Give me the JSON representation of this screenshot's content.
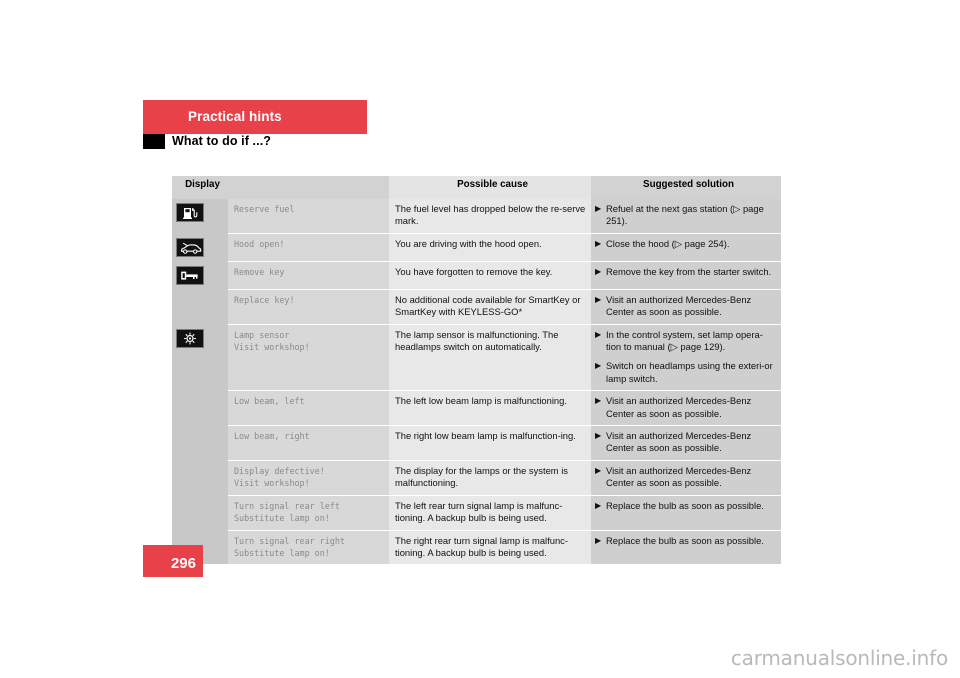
{
  "header": {
    "chapter": "Practical hints",
    "section_title": "What to do if ...?"
  },
  "page_number": "296",
  "watermark": "carmanualsonline.info",
  "table": {
    "columns": {
      "display": "Display",
      "possible_cause": "Possible cause",
      "suggested_solution": "Suggested solution"
    },
    "rows": [
      {
        "icon": "fuel-pump-icon",
        "display": "Reserve fuel",
        "cause": "The fuel level has dropped below the re-serve mark.",
        "solutions": [
          "Refuel at the next gas station (▷ page 251)."
        ]
      },
      {
        "icon": "hood-open-icon",
        "display": "Hood open!",
        "cause": "You are driving with the hood open.",
        "solutions": [
          "Close the hood (▷ page 254)."
        ]
      },
      {
        "icon": "key-icon",
        "display": "Remove key",
        "cause": "You have forgotten to remove the key.",
        "solutions": [
          "Remove the key from the starter switch."
        ]
      },
      {
        "icon": "",
        "display": "Replace key!",
        "cause": "No additional code available for SmartKey or SmartKey with KEYLESS-GO*",
        "solutions": [
          "Visit an authorized Mercedes-Benz Center as soon as possible."
        ]
      },
      {
        "icon": "lamp-sensor-icon",
        "display": "Lamp sensor\nVisit workshop!",
        "cause": "The lamp sensor is malfunctioning. The headlamps switch on automatically.",
        "solutions": [
          "In the control system, set lamp opera-tion to manual (▷ page 129).",
          "Switch on headlamps using the exteri-or lamp switch."
        ]
      },
      {
        "icon": "",
        "display": "Low beam, left",
        "cause": "The left low beam lamp is malfunctioning.",
        "solutions": [
          "Visit an authorized Mercedes-Benz Center as soon as possible."
        ]
      },
      {
        "icon": "",
        "display": "Low beam, right",
        "cause": "The right low beam lamp is malfunction-ing.",
        "solutions": [
          "Visit an authorized Mercedes-Benz Center as soon as possible."
        ]
      },
      {
        "icon": "",
        "display": "Display defective!\nVisit workshop!",
        "cause": "The display for the lamps or the system is malfunctioning.",
        "solutions": [
          "Visit an authorized Mercedes-Benz Center as soon as possible."
        ]
      },
      {
        "icon": "",
        "display": "Turn signal rear left\nSubstitute lamp on!",
        "cause": "The left rear turn signal lamp is malfunc-tioning. A backup bulb is being used.",
        "solutions": [
          "Replace the bulb as soon as possible."
        ]
      },
      {
        "icon": "",
        "display": "Turn signal rear right\nSubstitute lamp on!",
        "cause": "The right rear turn signal lamp is malfunc-tioning. A backup bulb is being used.",
        "solutions": [
          "Replace the bulb as soon as possible."
        ]
      }
    ]
  },
  "colors": {
    "accent_red": "#e8414a",
    "header_gray": "#d2d2d2",
    "icon_col_gray": "#c8c8c8",
    "display_col_gray": "#d8d8d8",
    "cause_col_gray": "#e8e8e8",
    "solution_col_gray": "#cfcfcf",
    "mono_text": "#8a8a8a"
  }
}
